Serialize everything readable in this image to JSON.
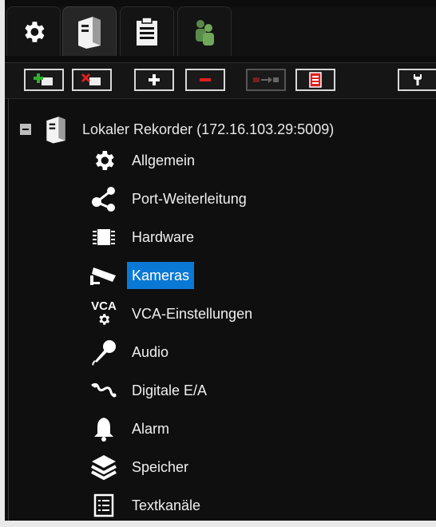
{
  "tabs": [
    {
      "icon": "gear-icon"
    },
    {
      "icon": "recorder-icon",
      "active": true
    },
    {
      "icon": "clipboard-icon"
    },
    {
      "icon": "users-icon"
    }
  ],
  "toolbar": {
    "buttons": [
      "add-recorder-icon",
      "remove-recorder-icon",
      "plus-icon",
      "minus-icon",
      "transfer-icon",
      "document-icon",
      "wrench-icon"
    ]
  },
  "tree": {
    "root_label": "Lokaler Rekorder (172.16.103.29:5009)",
    "items": [
      {
        "label": "Allgemein",
        "icon": "gear-icon"
      },
      {
        "label": "Port-Weiterleitung",
        "icon": "share-icon"
      },
      {
        "label": "Hardware",
        "icon": "chip-icon"
      },
      {
        "label": "Kameras",
        "icon": "camera-icon",
        "selected": true
      },
      {
        "label": "VCA-Einstellungen",
        "icon": "vca-icon",
        "icon_text": "VCA"
      },
      {
        "label": "Audio",
        "icon": "microphone-icon"
      },
      {
        "label": "Digitale E/A",
        "icon": "signal-icon"
      },
      {
        "label": "Alarm",
        "icon": "bell-icon"
      },
      {
        "label": "Speicher",
        "icon": "layers-icon"
      },
      {
        "label": "Textkanäle",
        "icon": "text-channel-icon"
      }
    ]
  },
  "colors": {
    "selected": "#0a79d6",
    "background": "#0f0f0f",
    "text": "#efefef"
  }
}
